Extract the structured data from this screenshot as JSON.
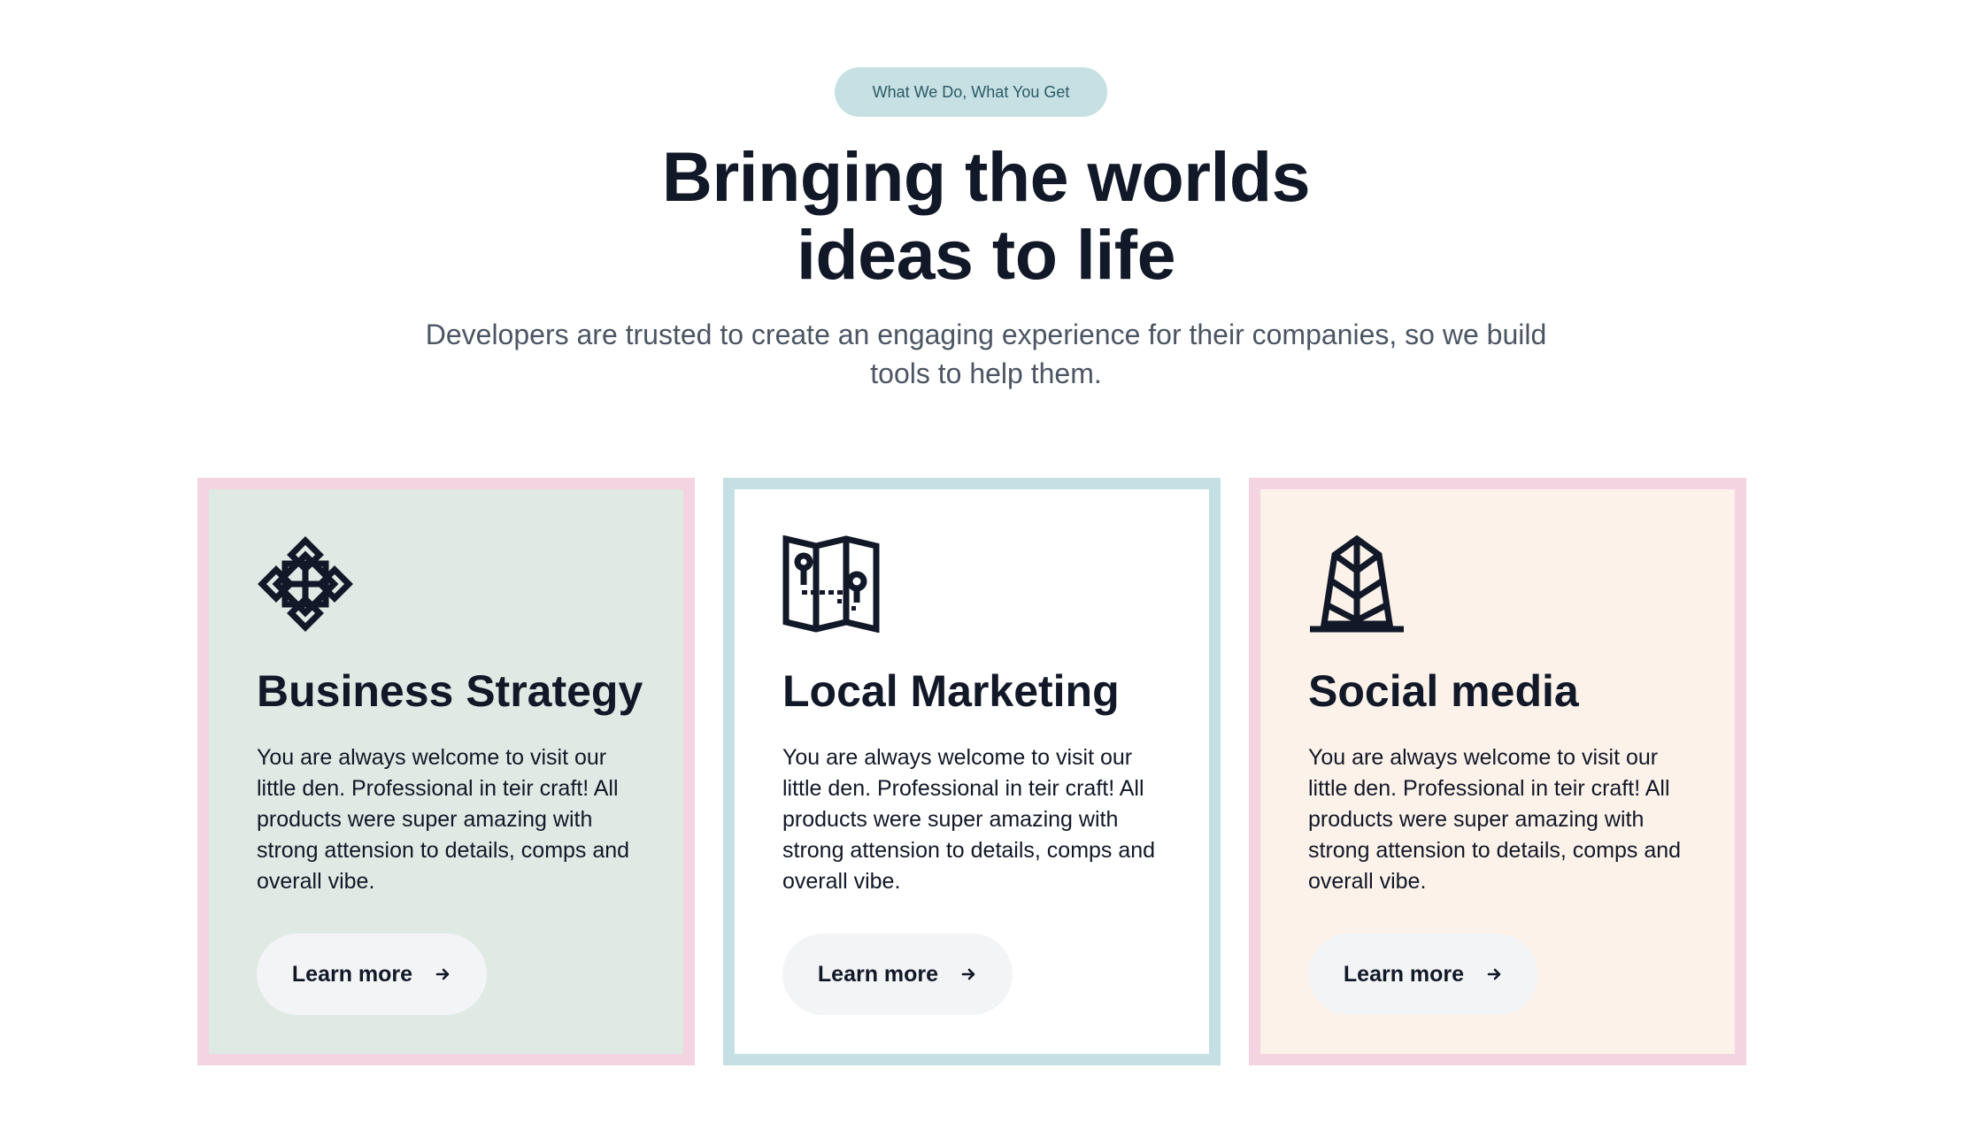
{
  "header": {
    "eyebrow": "What We Do, What You Get",
    "title_line1": "Bringing the worlds",
    "title_line2": "ideas to life",
    "subtitle": "Developers are trusted to create an engaging experience for their companies, so we build tools to help them."
  },
  "cards": [
    {
      "icon": "flower-icon",
      "title": "Business Strategy",
      "text": "You are always welcome to visit our little den. Professional in teir craft! All products were super amazing with strong attension to details, comps and overall vibe.",
      "button_label": "Learn more",
      "background": "#dfeae4",
      "border": "#f3d4e0"
    },
    {
      "icon": "map-icon",
      "title": "Local Marketing",
      "text": "You are always welcome to visit our little den. Professional in teir craft! All products were super amazing with strong attension to details, comps and overall vibe.",
      "button_label": "Learn more",
      "background": "#ffffff",
      "border": "#c5e0e4"
    },
    {
      "icon": "building-icon",
      "title": "Social media",
      "text": "You are always welcome to visit our little den. Professional in teir craft! All products were super amazing with strong attension to details, comps and overall vibe.",
      "button_label": "Learn more",
      "background": "#fcf2ea",
      "border": "#f3d4e0"
    }
  ],
  "colors": {
    "pill_bg": "#c6e0e4",
    "heading": "#111827",
    "subtitle": "#4b5563",
    "button_bg": "#f3f4f6"
  }
}
